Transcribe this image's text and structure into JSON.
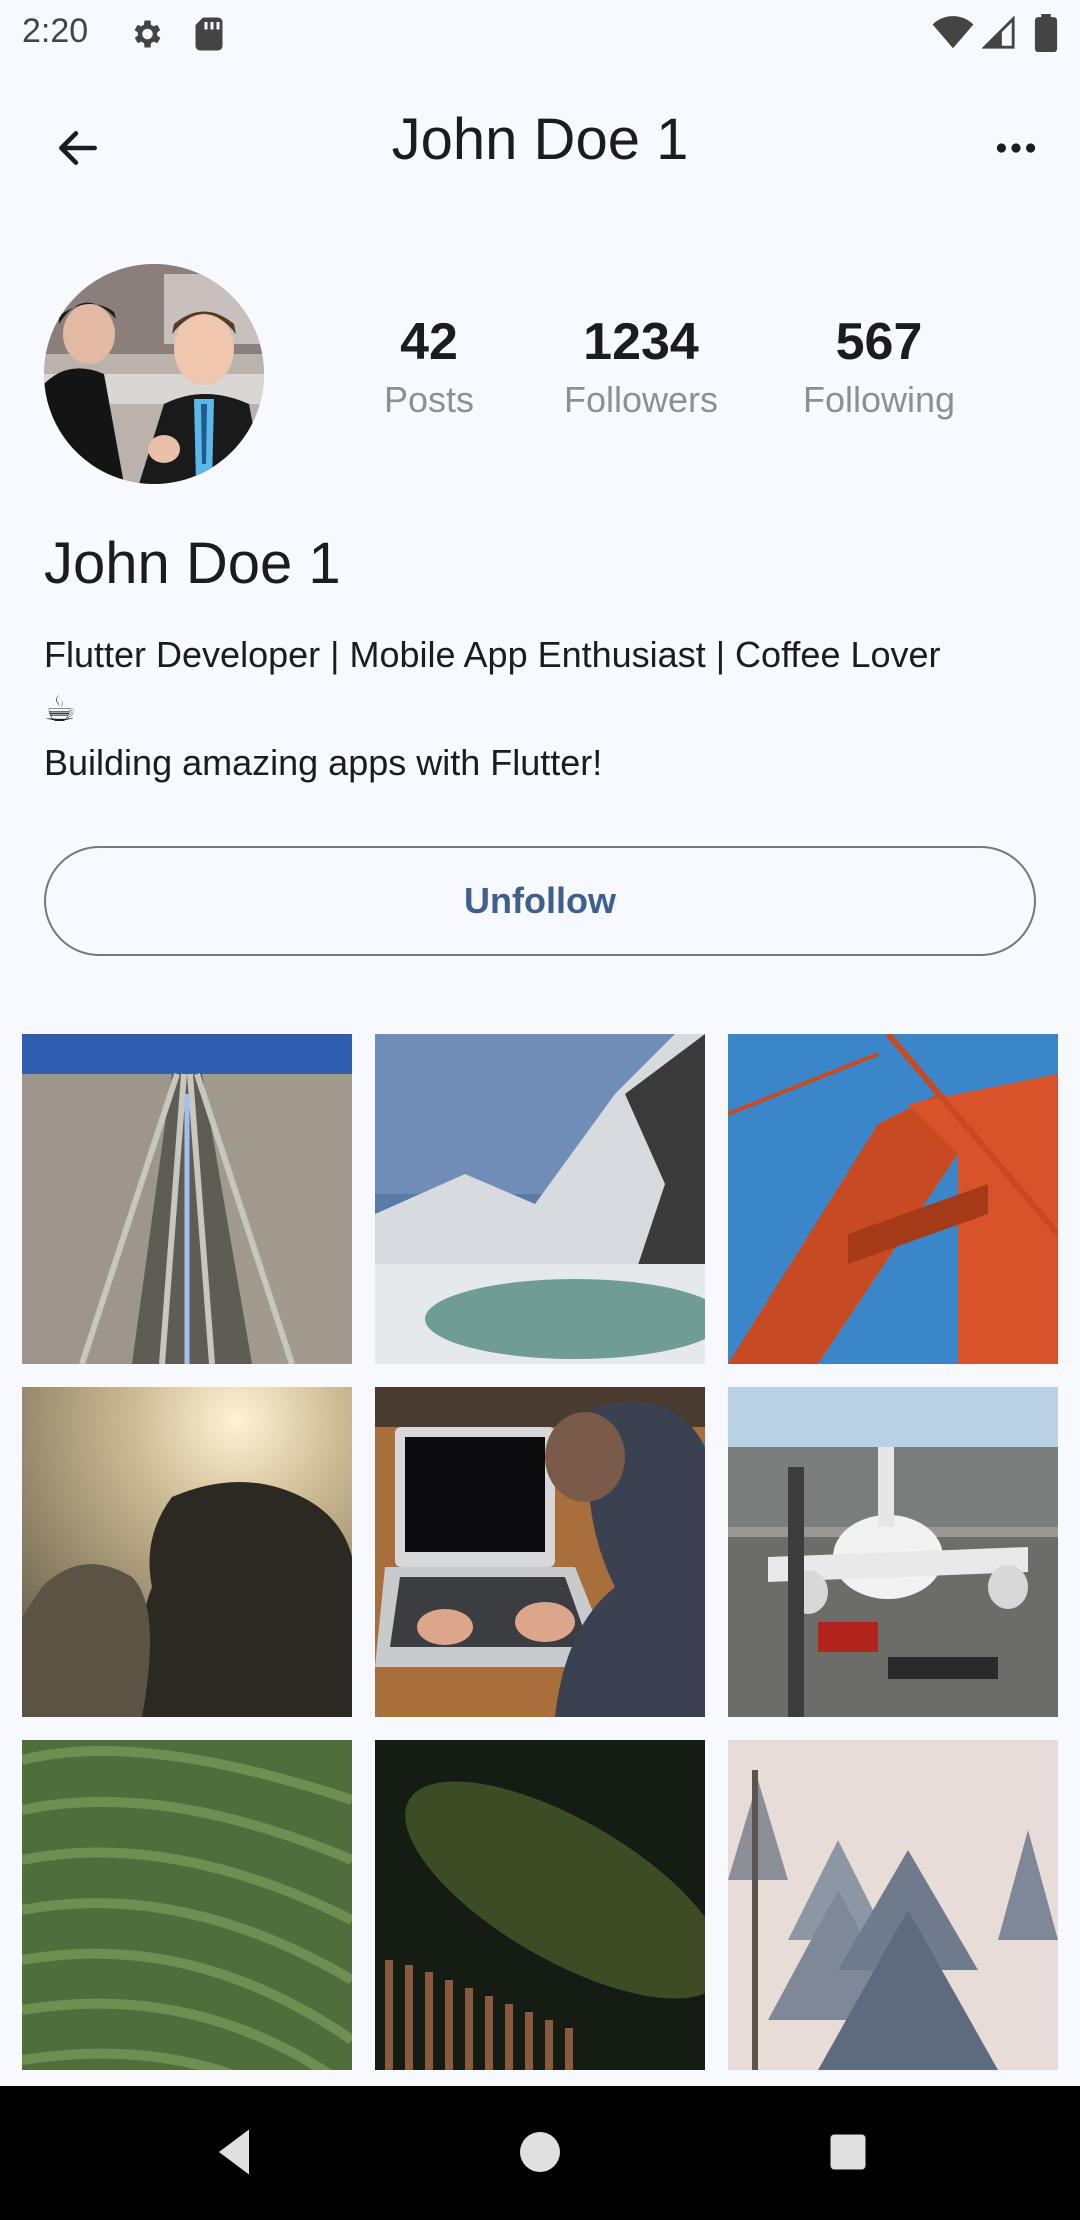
{
  "status_bar": {
    "time": "2:20",
    "icons": [
      "settings-gear-icon",
      "sd-card-icon",
      "wifi-icon",
      "cell-signal-icon",
      "battery-icon"
    ]
  },
  "app_bar": {
    "title": "John Doe 1",
    "back_icon": "arrow-back-icon",
    "more_icon": "more-horiz-icon"
  },
  "profile": {
    "name": "John Doe 1",
    "bio_line1": "Flutter Developer | Mobile App Enthusiast | Coffee Lover",
    "bio_emoji": "☕",
    "bio_line2": "Building amazing apps with Flutter!",
    "stats": [
      {
        "value": "42",
        "label": "Posts"
      },
      {
        "value": "1234",
        "label": "Followers"
      },
      {
        "value": "567",
        "label": "Following"
      }
    ],
    "action_label": "Unfollow"
  },
  "grid": {
    "tiles": [
      "railway tracks",
      "snowy mountains and lake",
      "red suspension bridge tower",
      "sun through fog and tree",
      "hands typing on laptop",
      "airplane at airport",
      "green crop field",
      "night sky over fence",
      "snowy pine trees"
    ]
  },
  "colors": {
    "background": "#f8f9ff",
    "primary_text": "#1c1b1f",
    "secondary_text": "#8e8e93",
    "accent": "#3f5f90",
    "outline": "#74777f"
  }
}
